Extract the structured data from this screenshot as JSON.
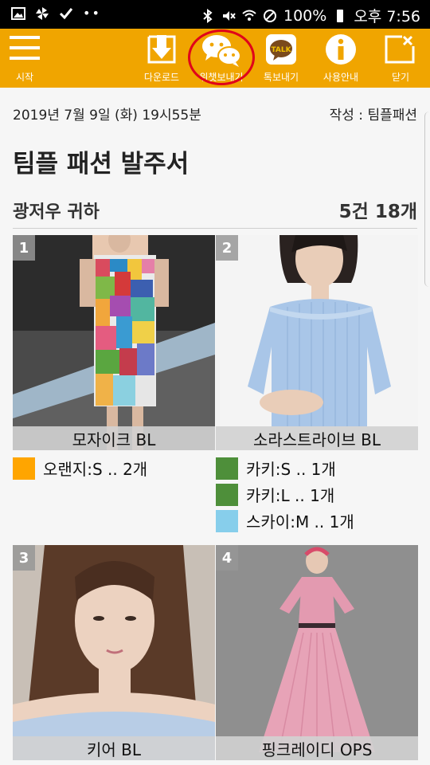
{
  "status_bar": {
    "battery": "100%",
    "time": "오후 7:56",
    "left_icons": [
      "image-icon",
      "pinwheel-icon",
      "check-icon",
      "more-dots-icon"
    ],
    "right_icons": [
      "bluetooth-icon",
      "mute-icon",
      "wifi-icon",
      "no-sim-icon",
      "battery-icon"
    ]
  },
  "toolbar": {
    "color": "#f0a500",
    "menu_label": "시작",
    "download_label": "다운로드",
    "wechat_label": "위챗보내기",
    "kakao_label": "톡보내기",
    "kakao_bubble_text": "TALK",
    "help_label": "사용안내",
    "close_label": "닫기",
    "highlight_color": "#e0001a"
  },
  "header": {
    "date": "2019년 7월 9일 (화) 19시55분",
    "author": "작성 : 팀플패션",
    "title": "팀플 패션 발주서",
    "recipient": "광저우 귀하",
    "summary": "5건 18개"
  },
  "items": [
    {
      "number": "1",
      "name": "모자이크 BL",
      "options": [
        {
          "label": "오랜지:S .. 2개",
          "color": "#ffa500"
        }
      ]
    },
    {
      "number": "2",
      "name": "소라스트라이브 BL",
      "options": [
        {
          "label": "카키:S .. 1개",
          "color": "#4e8f3a"
        },
        {
          "label": "카키:L .. 1개",
          "color": "#4e8f3a"
        },
        {
          "label": "스카이:M .. 1개",
          "color": "#87ceeb"
        }
      ]
    },
    {
      "number": "3",
      "name": "키어 BL",
      "options": []
    },
    {
      "number": "4",
      "name": "핑크레이디 OPS",
      "options": []
    }
  ]
}
